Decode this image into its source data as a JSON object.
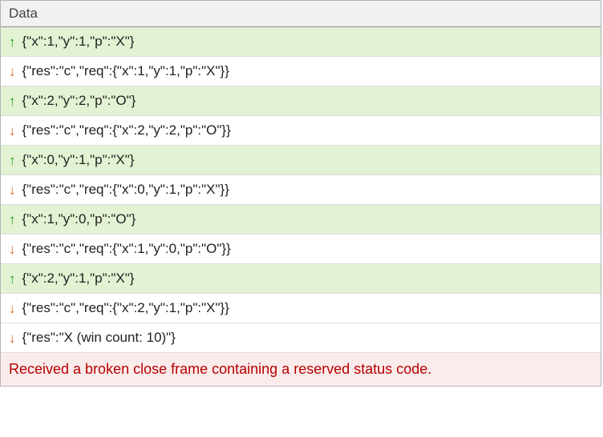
{
  "panel": {
    "title": "Data",
    "rows": [
      {
        "dir": "up",
        "text": "{\"x\":1,\"y\":1,\"p\":\"X\"}"
      },
      {
        "dir": "down",
        "text": "{\"res\":\"c\",\"req\":{\"x\":1,\"y\":1,\"p\":\"X\"}}"
      },
      {
        "dir": "up",
        "text": "{\"x\":2,\"y\":2,\"p\":\"O\"}"
      },
      {
        "dir": "down",
        "text": "{\"res\":\"c\",\"req\":{\"x\":2,\"y\":2,\"p\":\"O\"}}"
      },
      {
        "dir": "up",
        "text": "{\"x\":0,\"y\":1,\"p\":\"X\"}"
      },
      {
        "dir": "down",
        "text": "{\"res\":\"c\",\"req\":{\"x\":0,\"y\":1,\"p\":\"X\"}}"
      },
      {
        "dir": "up",
        "text": "{\"x\":1,\"y\":0,\"p\":\"O\"}"
      },
      {
        "dir": "down",
        "text": "{\"res\":\"c\",\"req\":{\"x\":1,\"y\":0,\"p\":\"O\"}}"
      },
      {
        "dir": "up",
        "text": "{\"x\":2,\"y\":1,\"p\":\"X\"}"
      },
      {
        "dir": "down",
        "text": "{\"res\":\"c\",\"req\":{\"x\":2,\"y\":1,\"p\":\"X\"}}"
      },
      {
        "dir": "down",
        "text": "{\"res\":\"X (win count: 10)\"}"
      }
    ],
    "error": "Received a broken close frame containing a reserved status code."
  }
}
